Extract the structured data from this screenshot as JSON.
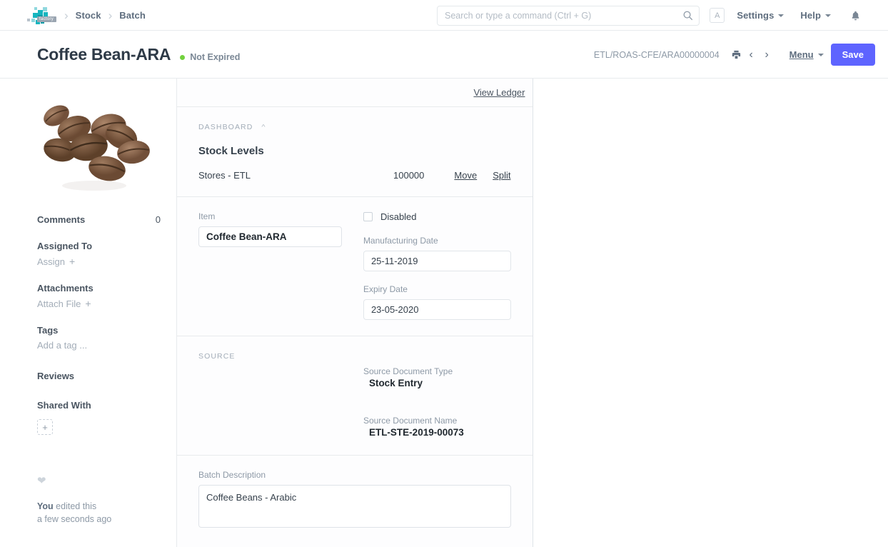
{
  "navbar": {
    "logo_tag": "factory",
    "breadcrumbs": [
      "Stock",
      "Batch"
    ],
    "search": {
      "placeholder": "Search or type a command (Ctrl + G)",
      "value": ""
    },
    "avatar_initial": "A",
    "settings_label": "Settings",
    "help_label": "Help",
    "bell_glyph": "🔔"
  },
  "page_head": {
    "title": "Coffee Bean-ARA",
    "status": "Not Expired",
    "status_color": "#72d13e",
    "doc_name": "ETL/ROAS-CFE/ARA00000004",
    "menu_label": "Menu",
    "save_label": "Save",
    "save_color": "#5e64ff"
  },
  "sidebar": {
    "comments_label": "Comments",
    "comments_count": "0",
    "assigned_to_label": "Assigned To",
    "assign_label": "Assign",
    "attachments_label": "Attachments",
    "attach_file_label": "Attach File",
    "tags_label": "Tags",
    "add_tag_label": "Add a tag ...",
    "reviews_label": "Reviews",
    "shared_with_label": "Shared With",
    "add_glyph": "+",
    "edited_by": "You",
    "edited_action": "edited this",
    "edited_time": "a few seconds ago"
  },
  "main": {
    "view_ledger_label": "View Ledger",
    "dashboard": {
      "section_label": "DASHBOARD",
      "title": "Stock Levels",
      "rows": [
        {
          "warehouse": "Stores - ETL",
          "qty": "100000",
          "move": "Move",
          "split": "Split"
        }
      ]
    },
    "details": {
      "item_label": "Item",
      "item_value": "Coffee Bean-ARA",
      "disabled_label": "Disabled",
      "disabled_checked": false,
      "manufacturing_date_label": "Manufacturing Date",
      "manufacturing_date_value": "25-11-2019",
      "expiry_date_label": "Expiry Date",
      "expiry_date_value": "23-05-2020"
    },
    "source": {
      "section_label": "SOURCE",
      "source_document_type_label": "Source Document Type",
      "source_document_type_value": "Stock Entry",
      "source_document_name_label": "Source Document Name",
      "source_document_name_value": "ETL-STE-2019-00073"
    },
    "description": {
      "label": "Batch Description",
      "value": "Coffee Beans - Arabic"
    }
  }
}
